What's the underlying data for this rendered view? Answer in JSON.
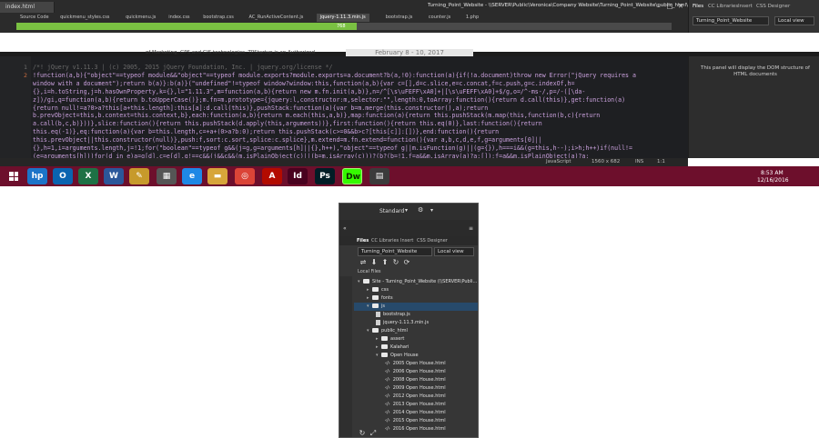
{
  "editor": {
    "doc_tab": "index.html",
    "window_title": "Turning_Point_Website - \\\\SERVER\\Public\\Veronica\\Company Website\\Turning_Point_Website\\public_html\\index.html",
    "related_files": [
      "Source Code",
      "quickmenu_styles.css",
      "quickmenu.js",
      "index.css",
      "bootstrap.css",
      "AC_RunActiveContent.js",
      "jquery-1.11.3.min.js",
      "bootstrap.js",
      "counter.js",
      "1.php"
    ],
    "active_related_file": "jquery-1.11.3.min.js",
    "progress_label": "768",
    "progress_percent": 52,
    "preview_text": "of Marketing, GPS and GIS technologies. TPStartup is an Authorized",
    "preview_date": "February 8 - 10, 2017",
    "line_numbers": [
      "1",
      "2"
    ],
    "code_lines": [
      "/*! jQuery v1.11.3 | (c) 2005, 2015 jQuery Foundation, Inc. | jquery.org/license */",
      "!function(a,b){\"object\"==typeof module&&\"object\"==typeof module.exports?module.exports=a.document?b(a,!0):function(a){if(!a.document)throw new Error(\"jQuery requires a",
      "window with a document\");return b(a)}:b(a)}(\"undefined\"!=typeof window?window:this,function(a,b){var c=[],d=c.slice,e=c.concat,f=c.push,g=c.indexOf,h=",
      "{},i=h.toString,j=h.hasOwnProperty,k={},l=\"1.11.3\",m=function(a,b){return new m.fn.init(a,b)},n=/^[\\s\\uFEFF\\xA0]+|[\\s\\uFEFF\\xA0]+$/g,o=/^-ms-/,p=/-([\\da-",
      "z])/gi,q=function(a,b){return b.toUpperCase()};m.fn=m.prototype={jquery:l,constructor:m,selector:\"\",length:0,toArray:function(){return d.call(this)},get:function(a)",
      "{return null!=a?0>a?this[a+this.length]:this[a]:d.call(this)},pushStack:function(a){var b=m.merge(this.constructor(),a);return",
      "b.prevObject=this,b.context=this.context,b},each:function(a,b){return m.each(this,a,b)},map:function(a){return this.pushStack(m.map(this,function(b,c){return",
      "a.call(b,c,b)}))},slice:function(){return this.pushStack(d.apply(this,arguments))},first:function(){return this.eq(0)},last:function(){return",
      "this.eq(-1)},eq:function(a){var b=this.length,c=+a+(0>a?b:0);return this.pushStack(c>=0&&b>c?[this[c]]:[])},end:function(){return",
      "this.prevObject||this.constructor(null)},push:f,sort:c.sort,splice:c.splice},m.extend=m.fn.extend=function(){var a,b,c,d,e,f,g=arguments[0]||",
      "{},h=1,i=arguments.length,j=!1;for(\"boolean\"==typeof g&&(j=g,g=arguments[h]||{},h++),\"object\"==typeof g||m.isFunction(g)||(g={}),h===i&&(g=this,h--);i>h;h++)if(null!=",
      "(e=arguments[h]))for(d in e)a=g[d],c=e[d],g!==c&&(j&&c&&(m.isPlainObject(c)||(b=m.isArray(c)))?(b?(b=!1,f=a&&m.isArray(a)?a:[]):f=a&&m.isPlainObject(a)?a:"
    ],
    "status": {
      "language": "JavaScript",
      "dimensions": "1560 x 682",
      "mode": "INS",
      "position": "1:1"
    }
  },
  "right_panel": {
    "tabs": [
      "Files",
      "CC Libraries",
      "Insert",
      "CSS Designer"
    ],
    "site_select": "Turning_Point_Website",
    "view_select": "Local view",
    "dom_message": "This panel will display the DOM structure of HTML documents"
  },
  "taskbar": {
    "apps": [
      {
        "icon": "windows-start-icon",
        "glyph": "",
        "color": "#6d0f2c"
      },
      {
        "icon": "hp-icon",
        "glyph": "hp",
        "color": "#1c74c8"
      },
      {
        "icon": "outlook-icon",
        "glyph": "O",
        "color": "#0a64b0"
      },
      {
        "icon": "excel-icon",
        "glyph": "X",
        "color": "#1e7145"
      },
      {
        "icon": "word-icon",
        "glyph": "W",
        "color": "#2b579a"
      },
      {
        "icon": "stickynotes-icon",
        "glyph": "✎",
        "color": "#c79a2b"
      },
      {
        "icon": "calculator-icon",
        "glyph": "▦",
        "color": "#555555"
      },
      {
        "icon": "ie-icon",
        "glyph": "e",
        "color": "#1e88e5"
      },
      {
        "icon": "explorer-icon",
        "glyph": "▬",
        "color": "#d7a53a"
      },
      {
        "icon": "chrome-icon",
        "glyph": "◎",
        "color": "#db4437"
      },
      {
        "icon": "acrobat-icon",
        "glyph": "A",
        "color": "#b30b00"
      },
      {
        "icon": "indesign-icon",
        "glyph": "Id",
        "color": "#49021f"
      },
      {
        "icon": "photoshop-icon",
        "glyph": "Ps",
        "color": "#001d26"
      },
      {
        "icon": "dreamweaver-icon",
        "glyph": "Dw",
        "color": "#35fa00"
      },
      {
        "icon": "app-icon",
        "glyph": "▤",
        "color": "#3b3b3b"
      }
    ],
    "time": "8:53 AM",
    "date": "12/16/2016"
  },
  "files_panel": {
    "workspace": "Standard",
    "tabs": [
      "Files",
      "CC Libraries",
      "Insert",
      "CSS Designer"
    ],
    "site_select": "Turning_Point_Website",
    "view_select": "Local view",
    "local_files_label": "Local Files",
    "tree": [
      {
        "label": "Site - Turning_Point_Website (\\\\SERVER\\Publi...",
        "indent": 0,
        "kind": "folder",
        "open": true,
        "selected": false
      },
      {
        "label": "css",
        "indent": 1,
        "kind": "folder",
        "open": false,
        "selected": false
      },
      {
        "label": "fonts",
        "indent": 1,
        "kind": "folder",
        "open": false,
        "selected": false
      },
      {
        "label": "js",
        "indent": 1,
        "kind": "folder",
        "open": true,
        "selected": true
      },
      {
        "label": "bootstrap.js",
        "indent": 2,
        "kind": "file",
        "open": false,
        "selected": false
      },
      {
        "label": "jquery-1.11.3.min.js",
        "indent": 2,
        "kind": "file",
        "open": false,
        "selected": false
      },
      {
        "label": "public_html",
        "indent": 1,
        "kind": "folder",
        "open": true,
        "selected": false
      },
      {
        "label": "assert",
        "indent": 2,
        "kind": "folder",
        "open": false,
        "selected": false
      },
      {
        "label": "Kalahari",
        "indent": 2,
        "kind": "folder",
        "open": false,
        "selected": false
      },
      {
        "label": "Open House",
        "indent": 2,
        "kind": "folder",
        "open": true,
        "selected": false
      },
      {
        "label": "2005 Open House.html",
        "indent": 3,
        "kind": "html",
        "open": false,
        "selected": false
      },
      {
        "label": "2006 Open House.html",
        "indent": 3,
        "kind": "html",
        "open": false,
        "selected": false
      },
      {
        "label": "2008 Open House.html",
        "indent": 3,
        "kind": "html",
        "open": false,
        "selected": false
      },
      {
        "label": "2009 Open House.html",
        "indent": 3,
        "kind": "html",
        "open": false,
        "selected": false
      },
      {
        "label": "2012 Open House.html",
        "indent": 3,
        "kind": "html",
        "open": false,
        "selected": false
      },
      {
        "label": "2013 Open House.html",
        "indent": 3,
        "kind": "html",
        "open": false,
        "selected": false
      },
      {
        "label": "2014 Open House.html",
        "indent": 3,
        "kind": "html",
        "open": false,
        "selected": false
      },
      {
        "label": "2015 Open House.html",
        "indent": 3,
        "kind": "html",
        "open": false,
        "selected": false
      },
      {
        "label": "2016 Open House.html",
        "indent": 3,
        "kind": "html",
        "open": false,
        "selected": false
      }
    ]
  }
}
